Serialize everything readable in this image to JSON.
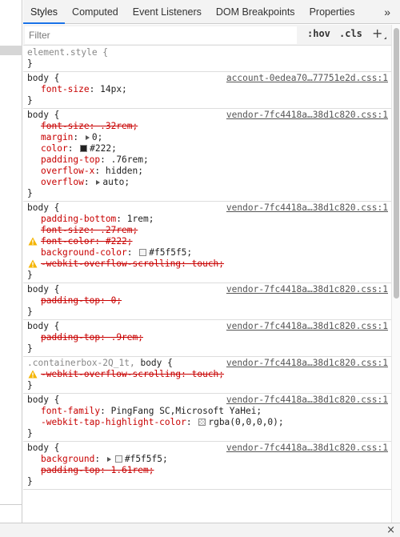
{
  "tabs": [
    {
      "label": "Styles",
      "active": true
    },
    {
      "label": "Computed"
    },
    {
      "label": "Event Listeners"
    },
    {
      "label": "DOM Breakpoints"
    },
    {
      "label": "Properties"
    }
  ],
  "tabs_more_label": "»",
  "filter": {
    "placeholder": "Filter",
    "value": "",
    "hov_label": ":hov",
    "cls_label": ".cls",
    "add_label": "+"
  },
  "rules": [
    {
      "selector": "element.style {",
      "source": "",
      "close": "}",
      "decls": []
    },
    {
      "selector": "body {",
      "source": "account-0edea70…77751e2d.css:1",
      "close": "}",
      "decls": [
        {
          "name": "font-size",
          "value": "14px;"
        }
      ]
    },
    {
      "selector": "body {",
      "source": "vendor-7fc4418a…38d1c820.css:1",
      "close": "}",
      "decls": [
        {
          "name": "font-size",
          "value": ".32rem;",
          "struck": true
        },
        {
          "name": "margin",
          "value": "0;",
          "expand": true
        },
        {
          "name": "color",
          "value": "#222;",
          "swatch": "#222222"
        },
        {
          "name": "padding-top",
          "value": ".76rem;"
        },
        {
          "name": "overflow-x",
          "value": "hidden;"
        },
        {
          "name": "overflow",
          "value": "auto;",
          "expand": true
        }
      ]
    },
    {
      "selector": "body {",
      "source": "vendor-7fc4418a…38d1c820.css:1",
      "close": "}",
      "decls": [
        {
          "name": "padding-bottom",
          "value": "1rem;"
        },
        {
          "name": "font-size",
          "value": ".27rem;",
          "struck": true
        },
        {
          "name": "font-color",
          "value": "#222;",
          "struck": true,
          "warning": true
        },
        {
          "name": "background-color",
          "value": "#f5f5f5;",
          "swatch": "#f5f5f5"
        },
        {
          "name": "-webkit-overflow-scrolling",
          "value": "touch;",
          "struck": true,
          "warning": true
        }
      ]
    },
    {
      "selector": "body {",
      "source": "vendor-7fc4418a…38d1c820.css:1",
      "close": "}",
      "decls": [
        {
          "name": "padding-top",
          "value": "0;",
          "struck": true
        }
      ]
    },
    {
      "selector": "body {",
      "source": "vendor-7fc4418a…38d1c820.css:1",
      "close": "}",
      "decls": [
        {
          "name": "padding-top",
          "value": ".9rem;",
          "struck": true
        }
      ]
    },
    {
      "selector_dim": ".containerbox-2Q_1t, ",
      "selector": "body {",
      "source": "vendor-7fc4418a…38d1c820.css:1",
      "close": "}",
      "decls": [
        {
          "name": "-webkit-overflow-scrolling",
          "value": "touch;",
          "struck": true,
          "warning": true
        }
      ]
    },
    {
      "selector": "body {",
      "source": "vendor-7fc4418a…38d1c820.css:1",
      "close": "}",
      "decls": [
        {
          "name": "font-family",
          "value": "PingFang SC,Microsoft YaHei;"
        },
        {
          "name": "-webkit-tap-highlight-color",
          "value": "rgba(0,0,0,0);",
          "swatch": "transparent"
        }
      ]
    },
    {
      "selector": "body {",
      "source": "vendor-7fc4418a…38d1c820.css:1",
      "close": "}",
      "decls": [
        {
          "name": "background",
          "value": "#f5f5f5;",
          "expand": true,
          "swatch": "#f5f5f5"
        },
        {
          "name": "padding-top",
          "value": "1.61rem;",
          "struck": true
        }
      ]
    }
  ],
  "bottom": {
    "close_label": "×"
  },
  "colors": {
    "accent": "#1a73e8",
    "property_name": "#c80000",
    "warning": "#f4b400"
  }
}
